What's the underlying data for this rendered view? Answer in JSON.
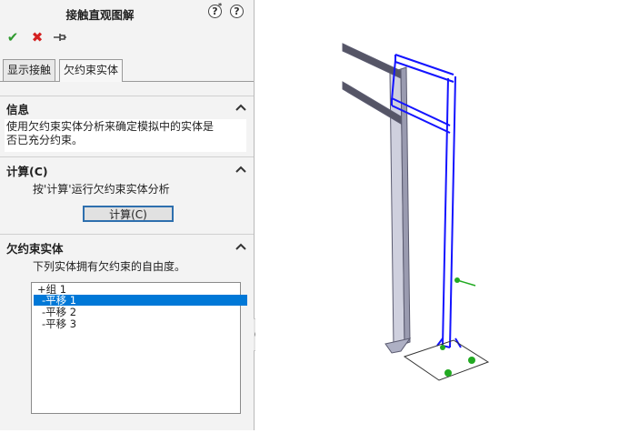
{
  "panel": {
    "title": "接触直观图解",
    "help_icon": "help-icon",
    "whats_new_icon": "whats-new-icon",
    "ok_icon": "check-icon",
    "cancel_icon": "close-icon",
    "pin_icon": "pin-icon"
  },
  "tabs": [
    {
      "label": "显示接触",
      "active": false
    },
    {
      "label": "欠约束实体",
      "active": true
    }
  ],
  "info": {
    "title": "信息",
    "line1": "使用欠约束实体分析来确定模拟中的实体是",
    "line2": "否已充分约束。"
  },
  "calculate": {
    "title": "计算(C)",
    "hint": "按'计算'运行欠约束实体分析",
    "button_label": "计算(C)"
  },
  "under_constrained": {
    "title": "欠约束实体",
    "hint": "下列实体拥有欠约束的自由度。",
    "items": [
      {
        "label": "+组 1",
        "selected": false
      },
      {
        "label": "-平移 1",
        "selected": true
      },
      {
        "label": "-平移 2",
        "selected": false
      },
      {
        "label": "-平移 3",
        "selected": false
      }
    ]
  },
  "colors": {
    "panel_bg": "#f3f3f3",
    "selection": "#0078d7",
    "highlight_body": "#1a1aff",
    "gray_body": "#c8c8d8",
    "fixture_green": "#22aa22"
  }
}
